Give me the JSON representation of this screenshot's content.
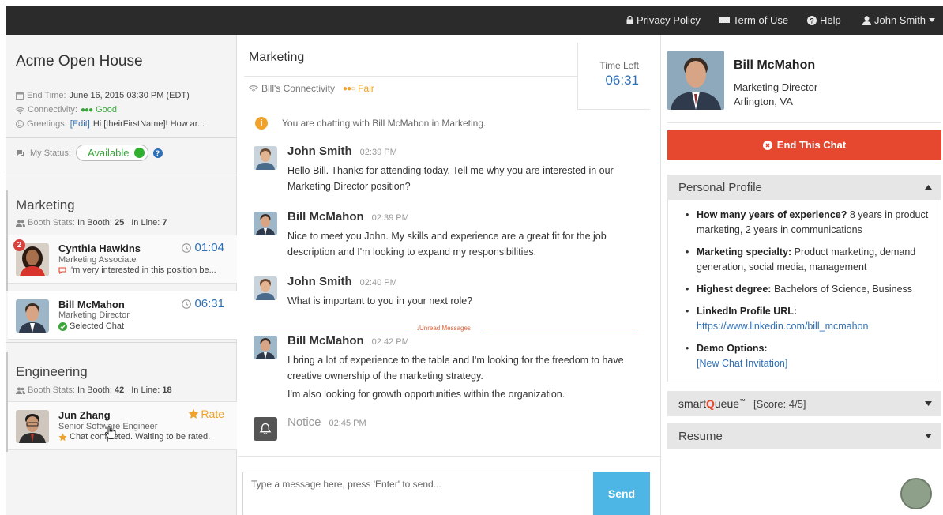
{
  "topnav": {
    "privacy": "Privacy Policy",
    "terms": "Term of Use",
    "help": "Help",
    "user": "John Smith"
  },
  "event": {
    "title": "Acme Open House",
    "end_time_label": "End Time:",
    "end_time_value": "June 16, 2015 03:30 PM (EDT)",
    "connectivity_label": "Connectivity:",
    "connectivity_value": "Good",
    "greetings_label": "Greetings:",
    "greetings_edit": "[Edit]",
    "greetings_text": "Hi [theirFirstName]! How ar...",
    "status_label": "My Status:",
    "status_value": "Available"
  },
  "booths": [
    {
      "name": "Marketing",
      "stats_label": "Booth Stats:",
      "in_booth_label": "In Booth:",
      "in_booth": "25",
      "in_line_label": "In Line:",
      "in_line": "7",
      "candidates": [
        {
          "badge": "2",
          "name": "Cynthia Hawkins",
          "role": "Marketing Associate",
          "note": "I'm very interested in this position be...",
          "timer": "01:04"
        },
        {
          "name": "Bill McMahon",
          "role": "Marketing Director",
          "note": "Selected Chat",
          "timer": "06:31"
        }
      ]
    },
    {
      "name": "Engineering",
      "stats_label": "Booth Stats:",
      "in_booth_label": "In Booth:",
      "in_booth": "42",
      "in_line_label": "In Line:",
      "in_line": "18",
      "candidates": [
        {
          "name": "Jun Zhang",
          "role": "Senior Software Engineer",
          "note": "Chat completed. Waiting to be rated.",
          "action": "Rate"
        }
      ]
    }
  ],
  "chat": {
    "department": "Marketing",
    "connectivity": "Bill's Connectivity",
    "connectivity_value": "Fair",
    "time_left_label": "Time Left",
    "time_left": "06:31",
    "info": "You are chatting with Bill McMahon in Marketing.",
    "messages": [
      {
        "name": "John Smith",
        "time": "02:39 PM",
        "text": "Hello Bill. Thanks for attending today. Tell me why you are interested in our Marketing Director position?"
      },
      {
        "name": "Bill McMahon",
        "time": "02:39 PM",
        "text": "Nice to meet you John. My skills and experience are a great fit for the job description and I'm looking to expand my responsibilities."
      },
      {
        "name": "John Smith",
        "time": "02:40 PM",
        "text": "What is important to you in your next role?"
      },
      {
        "name": "Bill McMahon",
        "time": "02:42 PM",
        "text": "I bring a lot of experience to the table and I'm looking for the freedom to have creative ownership of the marketing strategy.",
        "text2": "I'm also looking for growth opportunities within the organization."
      },
      {
        "name": "Notice",
        "time": "02:45 PM"
      }
    ],
    "unread_label": "Unread Messages",
    "input_placeholder": "Type a message here, press 'Enter' to send...",
    "send_label": "Send"
  },
  "profile": {
    "name": "Bill McMahon",
    "title": "Marketing Director",
    "location": "Arlington, VA",
    "end_chat": "End This Chat",
    "personal_profile": "Personal Profile",
    "items": [
      {
        "q": "How many years of experience?",
        "a": "8 years in product marketing, 2 years in communications"
      },
      {
        "q": "Marketing specialty:",
        "a": "Product marketing, demand generation, social media, management"
      },
      {
        "q": "Highest degree:",
        "a": "Bachelors of Science, Business"
      },
      {
        "q": "LinkedIn Profile URL:",
        "a": "https://www.linkedin.com/bill_mcmahon"
      },
      {
        "q": "Demo Options:",
        "a": "[New Chat Invitation]"
      }
    ],
    "smartqueue_pre": "smart",
    "smartqueue_q": "Q",
    "smartqueue_post": "ueue",
    "smartqueue_tm": "™",
    "smartqueue_score": "[Score: 4/5]",
    "resume": "Resume"
  },
  "colors": {
    "accent_blue": "#2d6fb6",
    "end_red": "#e5482f",
    "send_blue": "#4db6e5",
    "good_green": "#3aa63a",
    "fair_orange": "#f0a22a"
  }
}
